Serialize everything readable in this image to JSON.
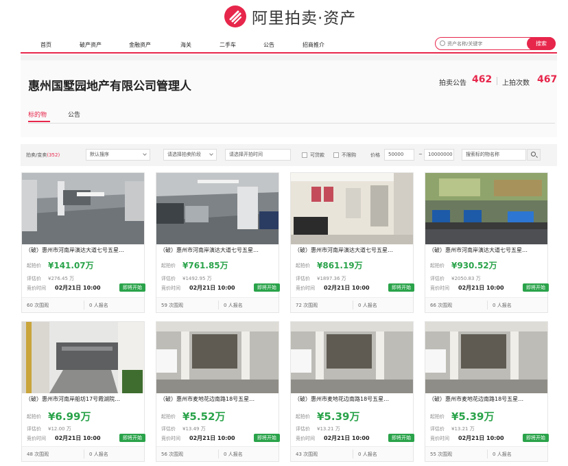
{
  "logo": {
    "text": "阿里拍卖·资产"
  },
  "nav": {
    "items": [
      "首页",
      "破产资产",
      "金融资产",
      "海关",
      "二手车",
      "公告",
      "招商推介"
    ],
    "search_placeholder": "资产名称/关键字",
    "search_button": "搜索"
  },
  "header": {
    "company": "惠州国墅园地产有限公司管理人",
    "auction_notice_label": "拍卖公告",
    "auction_notice_count": "462",
    "auction_times_label": "上拍次数",
    "auction_times_count": "467"
  },
  "tabs": [
    "标的物",
    "公告"
  ],
  "filter": {
    "category_label": "拍卖/变卖",
    "category_count": "(352)",
    "sort_select": "默认搜序",
    "stage_select": "请选择拍卖阶段",
    "time_input": "请选择开拍时间",
    "check1": "可贷款",
    "check2": "不限购",
    "price_label": "价格",
    "price_min": "50000",
    "price_sep": "~",
    "price_max": "10000000",
    "name_search_placeholder": "搜索标的物名称"
  },
  "labels": {
    "start_price": "起拍价",
    "eval_price": "评估价",
    "auction_time": "竞价时间",
    "visits_suffix": "次围观",
    "signup_suffix": "人报名",
    "status": "即将开始"
  },
  "colors": {
    "brand": "#e7264b",
    "price_green": "#2aa34a"
  },
  "items": [
    {
      "title": "（破）惠州市河南岸演达大道七号五星…",
      "price": "¥141.07万",
      "eval": "¥276.45 万",
      "date": "02月21日 10:00",
      "visits": "60",
      "signups": "0"
    },
    {
      "title": "（破）惠州市河南岸演达大道七号五星…",
      "price": "¥761.85万",
      "eval": "¥1492.95 万",
      "date": "02月21日 10:00",
      "visits": "59",
      "signups": "0"
    },
    {
      "title": "（破）惠州市河南岸演达大道七号五星…",
      "price": "¥861.19万",
      "eval": "¥1897.36 万",
      "date": "02月21日 10:00",
      "visits": "72",
      "signups": "0"
    },
    {
      "title": "（破）惠州市河南岸演达大道七号五星…",
      "price": "¥930.52万",
      "eval": "¥2050.83 万",
      "date": "02月21日 10:00",
      "visits": "66",
      "signups": "0"
    },
    {
      "title": "（破）惠州市河南岸船坊17号霞湖院…",
      "price": "¥6.99万",
      "eval": "¥12.00 万",
      "date": "02月21日 10:00",
      "visits": "48",
      "signups": "0"
    },
    {
      "title": "（破）惠州市麦地花边南路18号五星…",
      "price": "¥5.52万",
      "eval": "¥13.49 万",
      "date": "02月21日 10:00",
      "visits": "56",
      "signups": "0"
    },
    {
      "title": "（破）惠州市麦地花边南路18号五星…",
      "price": "¥5.39万",
      "eval": "¥13.21 万",
      "date": "02月21日 10:00",
      "visits": "43",
      "signups": "0"
    },
    {
      "title": "（破）惠州市麦地花边南路18号五星…",
      "price": "¥5.39万",
      "eval": "¥13.21 万",
      "date": "02月21日 10:00",
      "visits": "55",
      "signups": "0"
    }
  ]
}
